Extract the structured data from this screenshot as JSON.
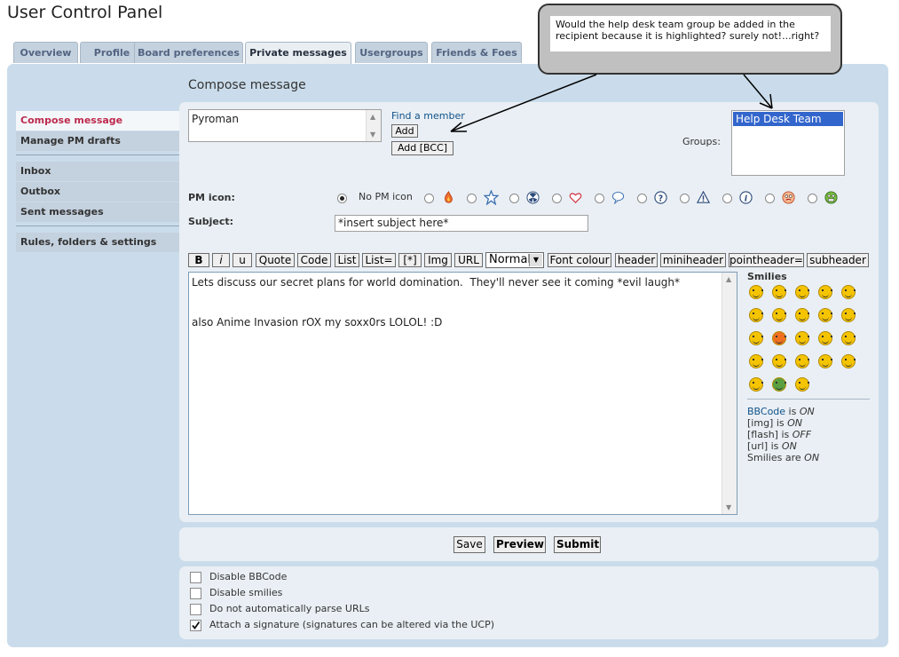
{
  "page_title": "User Control Panel",
  "tabs": [
    {
      "label": "Overview"
    },
    {
      "label": "Profile"
    },
    {
      "label": "Board preferences"
    },
    {
      "label": "Private messages",
      "active": true
    },
    {
      "label": "Usergroups"
    },
    {
      "label": "Friends & Foes"
    }
  ],
  "section_title": "Compose message",
  "nav": {
    "compose": "Compose message",
    "drafts": "Manage PM drafts",
    "inbox": "Inbox",
    "outbox": "Outbox",
    "sent": "Sent messages",
    "rules": "Rules, folders & settings"
  },
  "recipient": {
    "value": "Pyroman",
    "find_member": "Find a member",
    "add": "Add",
    "add_bcc": "Add [BCC]"
  },
  "groups": {
    "label": "Groups:",
    "selected": "Help Desk Team"
  },
  "pm_icon": {
    "label": "PM icon:",
    "none_label": "No PM icon",
    "icons": [
      "fire-icon",
      "star-icon",
      "radioactive-icon",
      "heart-icon",
      "speech-bubble-icon",
      "question-icon",
      "warning-icon",
      "info-icon",
      "smiley-red-icon",
      "smiley-green-icon"
    ]
  },
  "subject": {
    "label": "Subject:",
    "value": "*insert subject here*"
  },
  "toolbar": {
    "buttons": [
      "B",
      "i",
      "u",
      "Quote",
      "Code",
      "List",
      "List=",
      "[*]",
      "Img",
      "URL"
    ],
    "font_size": "Normal",
    "buttons2": [
      "Font colour",
      "header",
      "miniheader",
      "pointheader=",
      "subheader"
    ]
  },
  "message": {
    "line1": "Lets discuss our secret plans for world domination.  They'll never see it coming *evil laugh*",
    "line2": "also Anime Invasion rOX my soxx0rs LOLOL! :D"
  },
  "smilies": {
    "title": "Smilies",
    "count": 23
  },
  "status": {
    "bbcode_label": "BBCode",
    "bbcode_mid": " is ",
    "bbcode_val": "ON",
    "img_label": "[img] is ",
    "img_val": "ON",
    "flash_label": "[flash] is ",
    "flash_val": "OFF",
    "url_label": "[url] is ",
    "url_val": "ON",
    "smilies_label": "Smilies are ",
    "smilies_val": "ON"
  },
  "actions": {
    "save": "Save",
    "preview": "Preview",
    "submit": "Submit"
  },
  "options": {
    "disable_bbcode": "Disable BBCode",
    "disable_smilies": "Disable smilies",
    "no_parse_urls": "Do not automatically parse URLs",
    "attach_sig": "Attach a signature (signatures can be altered via the UCP)"
  },
  "callout": "Would the help desk team group be added in the recipient because it is highlighted? surely not!...right?",
  "colors": {
    "panel": "#cadceb",
    "active_nav": "#bc2a4d",
    "selected_group": "#3366cc"
  }
}
